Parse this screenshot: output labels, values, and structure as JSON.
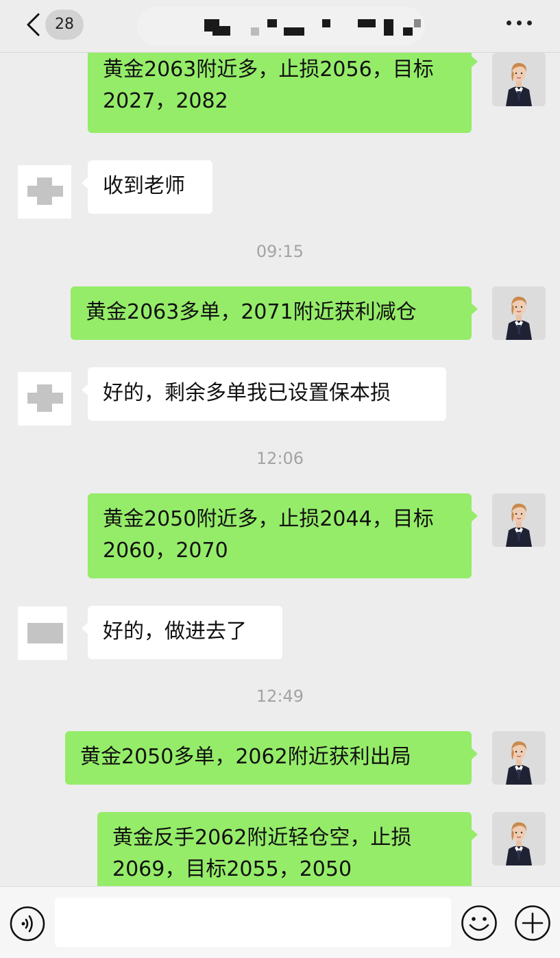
{
  "header": {
    "unread_count": "28",
    "icons": {
      "back": "chevron-left-icon",
      "more": "more-dots-icon"
    }
  },
  "messages": [
    {
      "from": "me",
      "text": "黄金2063附近多，止损2056，目标2027，2082"
    },
    {
      "from": "other",
      "text": "收到老师"
    },
    {
      "time": "09:15"
    },
    {
      "from": "me",
      "text": "黄金2063多单，2071附近获利减仓"
    },
    {
      "from": "other",
      "text": "好的，剩余多单我已设置保本损"
    },
    {
      "time": "12:06"
    },
    {
      "from": "me",
      "text": "黄金2050附近多，止损2044，目标2060，2070"
    },
    {
      "from": "other",
      "text": "好的，做进去了"
    },
    {
      "time": "12:49"
    },
    {
      "from": "me",
      "text": "黄金2050多单，2062附近获利出局"
    },
    {
      "from": "me",
      "text": "黄金反手2062附近轻仓空，止损2069，目标2055，2050"
    }
  ],
  "input_bar": {
    "message_value": "",
    "icons": {
      "voice": "voice-icon",
      "emoji": "emoji-icon",
      "add": "plus-circle-icon"
    }
  },
  "colors": {
    "background": "#ededed",
    "my_bubble": "#95ec69",
    "their_bubble": "#ffffff",
    "timestamp_text": "#a3a3a3"
  }
}
